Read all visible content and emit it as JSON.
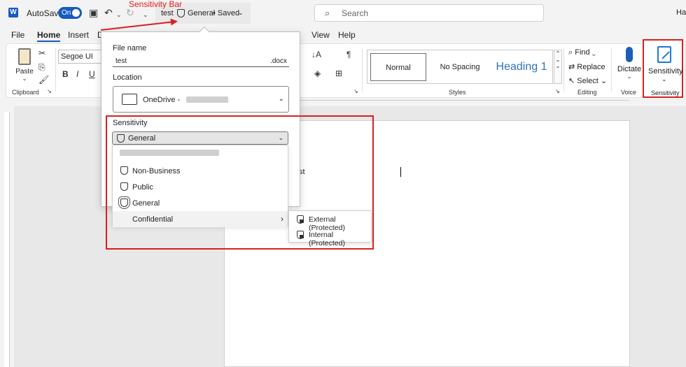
{
  "titlebar": {
    "autosave_label": "AutoSave",
    "toggle_state": "On",
    "doc_name": "test",
    "sensitivity": "General",
    "saved_state": "• Saved",
    "search_placeholder": "Search",
    "user_short": "Har"
  },
  "annotation": {
    "sensitivity_bar": "Sensitivity Bar"
  },
  "tabs": [
    "File",
    "Home",
    "Insert",
    "D",
    "View",
    "Help"
  ],
  "ribbon": {
    "paste": "Paste",
    "clipboard": "Clipboard",
    "font_name": "Segoe UI",
    "bold": "B",
    "italic": "I",
    "underline": "U",
    "styles": [
      "Normal",
      "No Spacing",
      "Heading 1"
    ],
    "styles_group": "Styles",
    "find": "Find",
    "replace": "Replace",
    "select": "Select",
    "editing_group": "Editing",
    "dictate": "Dictate",
    "voice_group": "Voice",
    "sensitivity": "Sensitivity",
    "sensitivity_group": "Sensitivity"
  },
  "panel": {
    "file_name_label": "File name",
    "file_name_value": "test",
    "file_ext": ".docx",
    "location_label": "Location",
    "location_value": "OneDrive -",
    "sensitivity_label": "Sensitivity",
    "sensitivity_value": "General"
  },
  "sensitivity_menu": {
    "items": [
      "Non-Business",
      "Public",
      "General",
      "Confidential"
    ],
    "selected": "General",
    "submenu": [
      "External (Protected)",
      "Internal (Protected)"
    ]
  },
  "document": {
    "text": "st"
  },
  "colors": {
    "accent": "#185abd",
    "annotation_red": "#d92020"
  }
}
